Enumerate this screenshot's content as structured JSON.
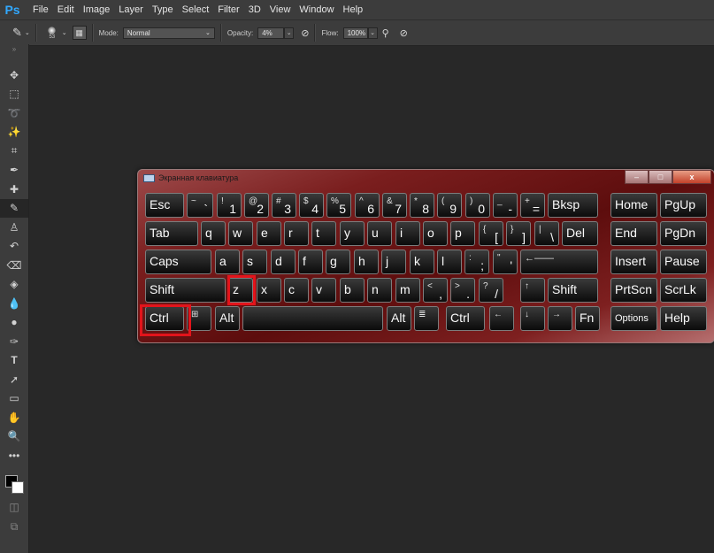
{
  "app": {
    "logo": "Ps"
  },
  "menu": [
    "File",
    "Edit",
    "Image",
    "Layer",
    "Type",
    "Select",
    "Filter",
    "3D",
    "View",
    "Window",
    "Help"
  ],
  "options": {
    "brush_size": "53",
    "mode_label": "Mode:",
    "mode_value": "Normal",
    "opacity_label": "Opacity:",
    "opacity_value": "4%",
    "flow_label": "Flow:",
    "flow_value": "100%"
  },
  "tools": [
    "move-icon",
    "marquee-icon",
    "lasso-icon",
    "magic-wand-icon",
    "crop-icon",
    "eyedropper-icon",
    "healing-icon",
    "brush-icon",
    "stamp-icon",
    "history-brush-icon",
    "eraser-icon",
    "paint-bucket-icon",
    "blur-icon",
    "dodge-icon",
    "pen-icon",
    "type-icon",
    "path-select-icon",
    "rectangle-icon",
    "hand-icon",
    "zoom-icon",
    "more-icon"
  ],
  "osk": {
    "title": "Экранная клавиатура",
    "window_buttons": {
      "min": "–",
      "max": "□",
      "close": "x"
    },
    "highlight_color": "#e3141b"
  },
  "keys": {
    "esc": "Esc",
    "grave_top": "~",
    "grave_bot": "`",
    "k1_top": "!",
    "k1": "1",
    "k2_top": "@",
    "k2": "2",
    "k3_top": "#",
    "k3": "3",
    "k4_top": "$",
    "k4": "4",
    "k5_top": "%",
    "k5": "5",
    "k6_top": "^",
    "k6": "6",
    "k7_top": "&",
    "k7": "7",
    "k8_top": "*",
    "k8": "8",
    "k9_top": "(",
    "k9": "9",
    "k0_top": ")",
    "k0": "0",
    "minus_top": "_",
    "minus": "-",
    "eq_top": "+",
    "eq": "=",
    "bksp": "Bksp",
    "home": "Home",
    "pgup": "PgUp",
    "tab": "Tab",
    "q": "q",
    "w": "w",
    "e": "e",
    "r": "r",
    "t": "t",
    "y": "y",
    "u": "u",
    "i": "i",
    "o": "o",
    "p": "p",
    "lbr_top": "{",
    "lbr": "[",
    "rbr_top": "}",
    "rbr": "]",
    "bsl_top": "|",
    "bsl": "\\",
    "del": "Del",
    "end": "End",
    "pgdn": "PgDn",
    "caps": "Caps",
    "a": "a",
    "s": "s",
    "d": "d",
    "f": "f",
    "g": "g",
    "h": "h",
    "j": "j",
    "k": "k",
    "l": "l",
    "semi_top": ":",
    "semi": ";",
    "quote_top": "\"",
    "quote": "'",
    "enter": "←——",
    "insert": "Insert",
    "pause": "Pause",
    "shift": "Shift",
    "z": "z",
    "x": "x",
    "c": "c",
    "v": "v",
    "b": "b",
    "n": "n",
    "m": "m",
    "comma_top": "<",
    "comma": ",",
    "dot_top": ">",
    "dot": ".",
    "slash_top": "?",
    "slash": "/",
    "up": "↑",
    "shift_r": "Shift",
    "prtscn": "PrtScn",
    "scrlk": "ScrLk",
    "ctrl": "Ctrl",
    "win": "⊞",
    "alt": "Alt",
    "alt_r": "Alt",
    "menu": "≣",
    "ctrl_r": "Ctrl",
    "left": "←",
    "down": "↓",
    "right": "→",
    "fn": "Fn",
    "options": "Options",
    "help": "Help"
  }
}
